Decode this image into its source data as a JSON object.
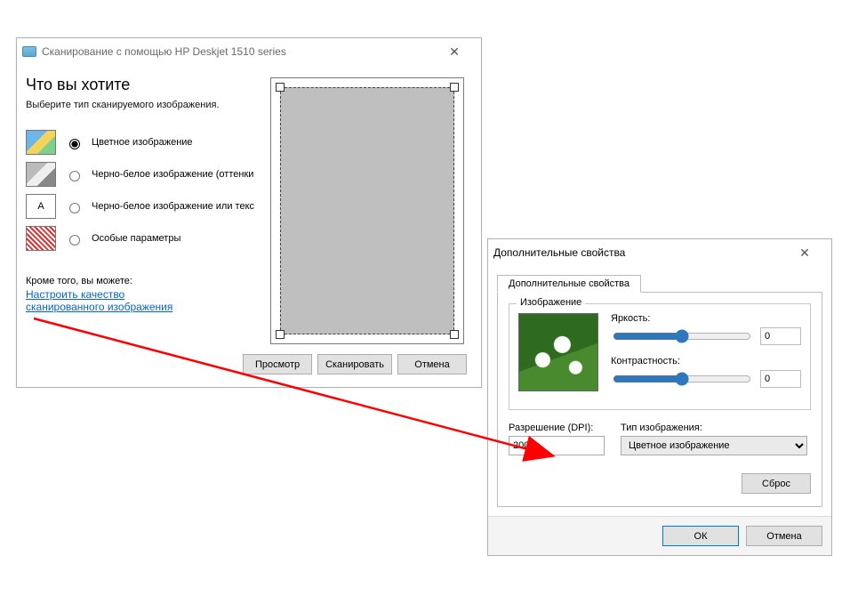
{
  "dlg1": {
    "title": "Сканирование с помощью HP Deskjet 1510 series",
    "heading": "Что вы хотите",
    "subheading": "Выберите тип сканируемого изображения.",
    "options": {
      "color": "Цветное изображение",
      "gray": "Черно-белое изображение (оттенки",
      "bw": "Черно-белое изображение или текс",
      "custom": "Особые параметры"
    },
    "also_label": "Кроме того, вы можете:",
    "link": "Настроить качество сканированного изображения",
    "buttons": {
      "preview": "Просмотр",
      "scan": "Сканировать",
      "cancel": "Отмена"
    }
  },
  "dlg2": {
    "title": "Дополнительные свойства",
    "tab": "Дополнительные свойства",
    "group_image": "Изображение",
    "brightness_label": "Яркость:",
    "brightness_value": "0",
    "contrast_label": "Контрастность:",
    "contrast_value": "0",
    "resolution_label": "Разрешение (DPI):",
    "resolution_value": "200",
    "type_label": "Тип изображения:",
    "type_value": "Цветное изображение",
    "reset": "Сброс",
    "ok": "ОК",
    "cancel": "Отмена"
  }
}
